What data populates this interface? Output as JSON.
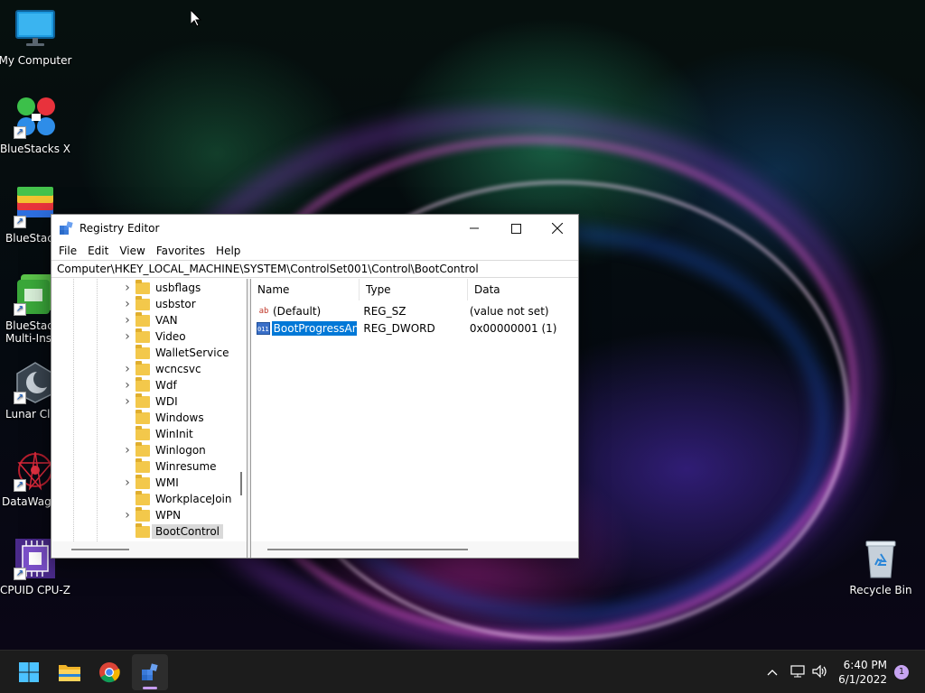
{
  "desktop": {
    "icons": [
      {
        "label": "My Computer"
      },
      {
        "label": "BlueStacks X"
      },
      {
        "label": "BlueStacks"
      },
      {
        "label": "BlueStacks Multi-Inst"
      },
      {
        "label": "Lunar Clie"
      },
      {
        "label": "DataWago"
      },
      {
        "label": "CPUID CPU-Z"
      }
    ],
    "recycle_bin": "Recycle Bin"
  },
  "window": {
    "title": "Registry Editor",
    "menu": [
      "File",
      "Edit",
      "View",
      "Favorites",
      "Help"
    ],
    "address": "Computer\\HKEY_LOCAL_MACHINE\\SYSTEM\\ControlSet001\\Control\\BootControl",
    "tree": [
      {
        "label": "usbflags",
        "expandable": true
      },
      {
        "label": "usbstor",
        "expandable": true
      },
      {
        "label": "VAN",
        "expandable": true
      },
      {
        "label": "Video",
        "expandable": true
      },
      {
        "label": "WalletService",
        "expandable": false
      },
      {
        "label": "wcncsvc",
        "expandable": true
      },
      {
        "label": "Wdf",
        "expandable": true
      },
      {
        "label": "WDI",
        "expandable": true
      },
      {
        "label": "Windows",
        "expandable": false
      },
      {
        "label": "WinInit",
        "expandable": false
      },
      {
        "label": "Winlogon",
        "expandable": true
      },
      {
        "label": "Winresume",
        "expandable": false
      },
      {
        "label": "WMI",
        "expandable": true
      },
      {
        "label": "WorkplaceJoin",
        "expandable": false
      },
      {
        "label": "WPN",
        "expandable": true
      },
      {
        "label": "BootControl",
        "expandable": false,
        "selected": true
      }
    ],
    "columns": {
      "name": "Name",
      "type": "Type",
      "data": "Data"
    },
    "values": [
      {
        "name": "(Default)",
        "type": "REG_SZ",
        "data": "(value not set)",
        "icon": "ab"
      },
      {
        "name": "BootProgressAn...",
        "type": "REG_DWORD",
        "data": "0x00000001 (1)",
        "icon": "011",
        "selected": true
      }
    ]
  },
  "taskbar": {
    "time": "6:40 PM",
    "date": "6/1/2022",
    "notifications": "1"
  }
}
